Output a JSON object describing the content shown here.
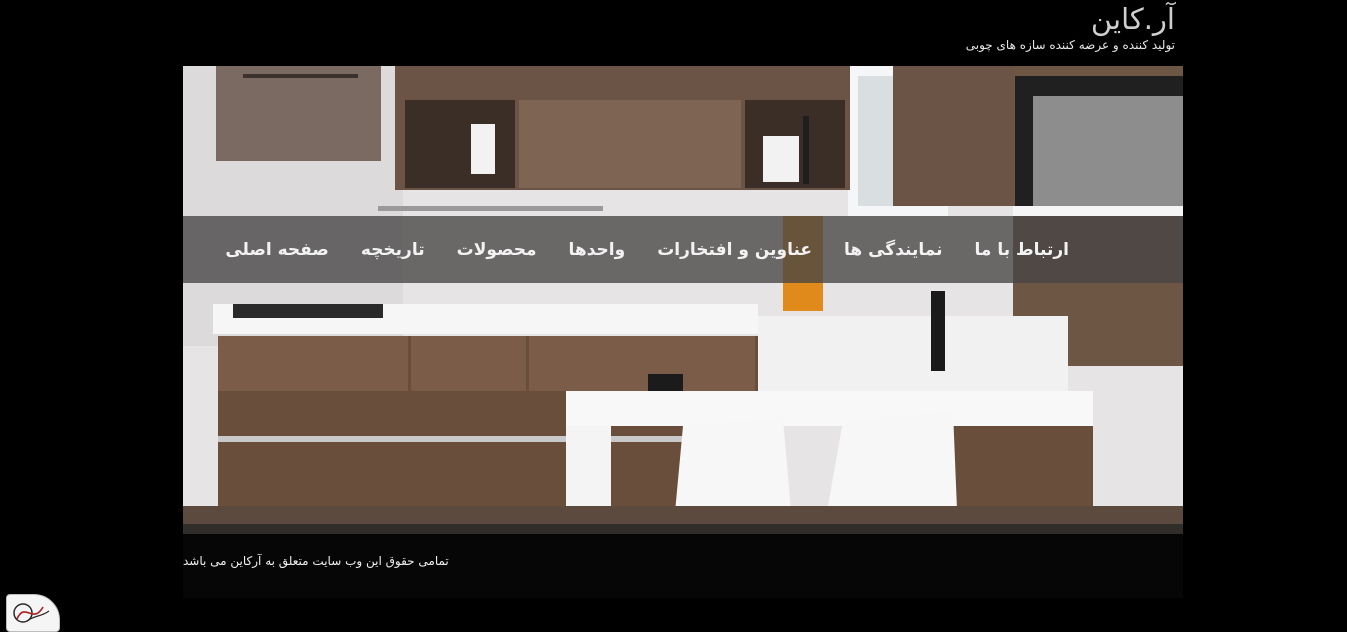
{
  "brand": {
    "title": "آر.کاین",
    "tagline": "تولید کننده و عرضه کننده سازه های چوبی"
  },
  "nav": {
    "items": [
      {
        "label": "صفحه اصلی"
      },
      {
        "label": "تاریخچه"
      },
      {
        "label": "محصولات"
      },
      {
        "label": "واحدها"
      },
      {
        "label": "عناوین و افتخارات"
      },
      {
        "label": "نمایندگی ها"
      },
      {
        "label": "ارتباط با ما"
      }
    ]
  },
  "footer": {
    "copyright": "تمامی حقوق این وب سایت متعلق به آرکاین می باشد"
  },
  "colors": {
    "background": "#000000",
    "nav_bg": "#464444",
    "text": "#f2f2f2"
  }
}
